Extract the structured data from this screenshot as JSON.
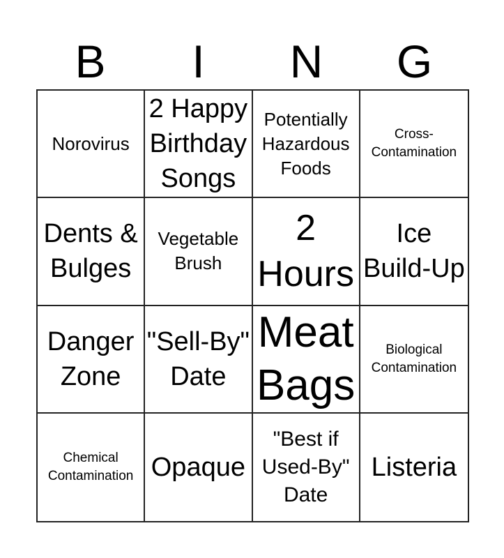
{
  "title_letters": [
    "B",
    "I",
    "N",
    "G"
  ],
  "cells": [
    {
      "text": "Norovirus",
      "size": "s-sm"
    },
    {
      "text": "2 Happy Birthday Songs",
      "size": "s-lg"
    },
    {
      "text": "Potentially Hazardous Foods",
      "size": "s-sm"
    },
    {
      "text": "Cross-Contamination",
      "size": "s-xs"
    },
    {
      "text": "Dents & Bulges",
      "size": "s-lg"
    },
    {
      "text": "Vegetable Brush",
      "size": "s-sm"
    },
    {
      "text": "2 Hours",
      "size": "s-xl"
    },
    {
      "text": "Ice Build-Up",
      "size": "s-lg"
    },
    {
      "text": "Danger Zone",
      "size": "s-lg"
    },
    {
      "text": "\"Sell-By\" Date",
      "size": "s-lg"
    },
    {
      "text": "Meat Bags",
      "size": "s-xxl"
    },
    {
      "text": "Biological Contamination",
      "size": "s-xs"
    },
    {
      "text": "Chemical Contamination",
      "size": "s-xs"
    },
    {
      "text": "Opaque",
      "size": "s-lg"
    },
    {
      "text": "\"Best if Used-By\" Date",
      "size": "s-md"
    },
    {
      "text": "Listeria",
      "size": "s-lg"
    }
  ]
}
